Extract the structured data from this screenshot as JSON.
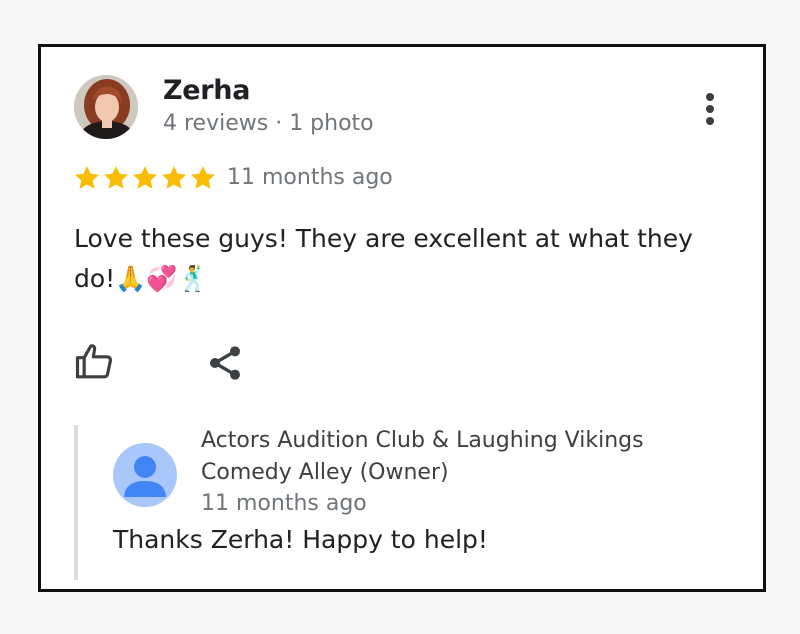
{
  "review": {
    "author_name": "Zerha",
    "author_meta": "4 reviews · 1 photo",
    "rating": 5,
    "rating_max": 5,
    "time_ago": "11 months ago",
    "text": "Love these guys! They are excellent at what they do!🙏💞🕺"
  },
  "owner_response": {
    "name": "Actors Audition Club & Laughing Vikings Comedy Alley (Owner)",
    "time_ago": "11 months ago",
    "text": "Thanks Zerha! Happy to help!"
  },
  "icons": {
    "menu": "more-vert-icon",
    "like": "thumb-up-icon",
    "share": "share-icon",
    "star": "star-icon",
    "owner_avatar": "person-icon"
  },
  "colors": {
    "star": "#fbbc04",
    "text": "#202124",
    "muted": "#70757a",
    "owner_avatar_bg": "#a8c7fa",
    "owner_avatar_fg": "#4285f4",
    "reply_border": "#dadce0"
  }
}
